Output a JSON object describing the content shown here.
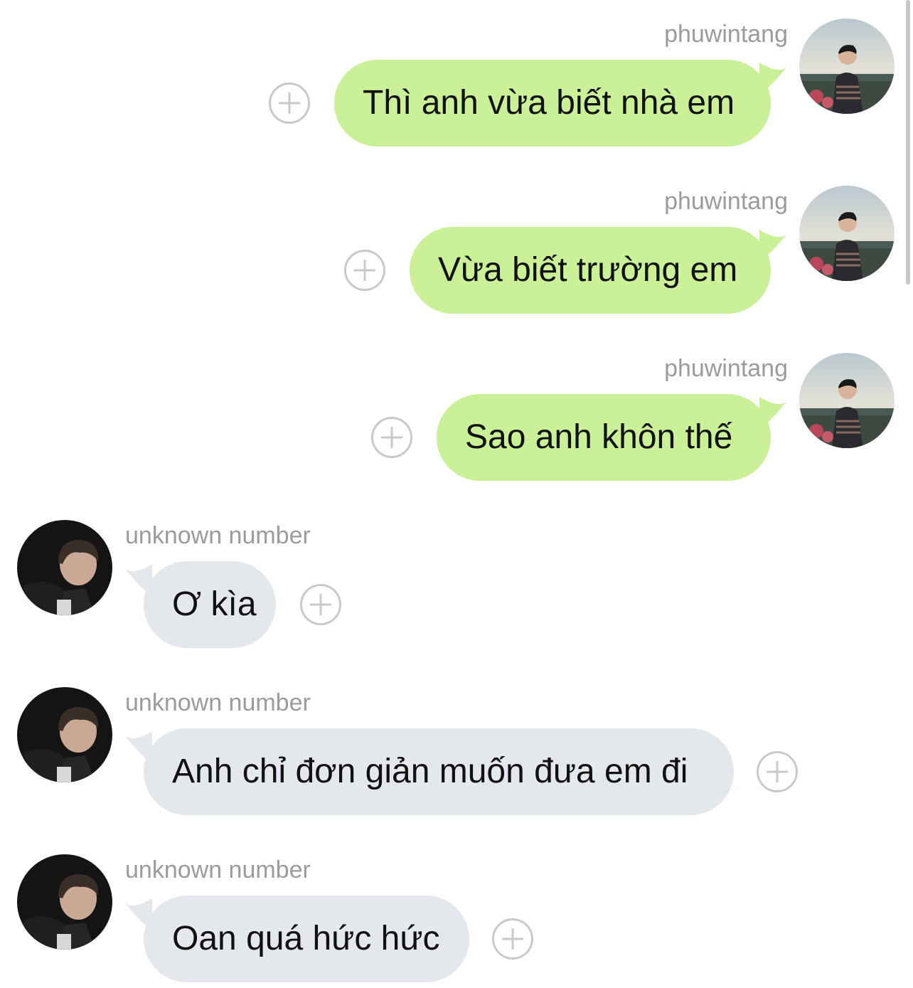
{
  "messages": [
    {
      "sender": "phuwintang",
      "text": "Thì anh vừa biết nhà em",
      "direction": "outgoing"
    },
    {
      "sender": "phuwintang",
      "text": "Vừa biết trường em",
      "direction": "outgoing"
    },
    {
      "sender": "phuwintang",
      "text": "Sao anh khôn thế",
      "direction": "outgoing"
    },
    {
      "sender": "unknown number",
      "text": "Ơ kìa",
      "direction": "incoming"
    },
    {
      "sender": "unknown number",
      "text": "Anh chỉ đơn giản muốn đưa em đi",
      "direction": "incoming"
    },
    {
      "sender": "unknown number",
      "text": "Oan quá hức hức",
      "direction": "incoming"
    }
  ],
  "icons": {
    "react": "add-reaction-icon",
    "outgoing_avatar": "avatar-photo",
    "incoming_avatar": "avatar-photo"
  },
  "colors": {
    "outgoing_bubble": "#caf198",
    "incoming_bubble": "#e4e8ec",
    "sender_name": "#9b9b9b",
    "plus_icon": "#c9c9c9"
  }
}
